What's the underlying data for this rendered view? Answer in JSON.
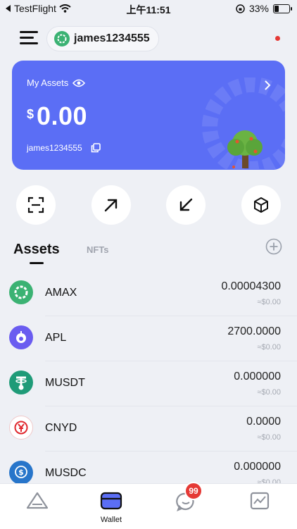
{
  "status_bar": {
    "back_app": "TestFlight",
    "time": "上午11:51",
    "battery": "33%",
    "icons": [
      "back-arrow-icon",
      "wifi-icon",
      "orientation-lock-icon",
      "battery-icon"
    ]
  },
  "header": {
    "account_name": "james1234555",
    "icons": [
      "menu-icon",
      "amax-logo-icon",
      "notification-dot"
    ]
  },
  "card": {
    "label": "My Assets",
    "currency": "$",
    "balance": "0.00",
    "account": "james1234555",
    "colors": {
      "background": "#5b6ef5",
      "text": "#ffffff"
    },
    "icons": [
      "eye-icon",
      "chevron-right-icon",
      "copy-icon",
      "tree-illustration"
    ]
  },
  "actions": [
    {
      "name": "scan",
      "icon": "scan-icon"
    },
    {
      "name": "send",
      "icon": "arrow-up-right-icon"
    },
    {
      "name": "receive",
      "icon": "arrow-down-left-icon"
    },
    {
      "name": "resources",
      "icon": "cube-icon"
    }
  ],
  "tabs": {
    "assets": "Assets",
    "nfts": "NFTs",
    "active": "Assets"
  },
  "tokens": [
    {
      "symbol": "AMAX",
      "balance": "0.00004300",
      "fiat": "≈$0.00",
      "icon": "amax-token-icon",
      "color": "#3bb273"
    },
    {
      "symbol": "APL",
      "balance": "2700.0000",
      "fiat": "≈$0.00",
      "icon": "apl-token-icon",
      "color": "#6a5cf0"
    },
    {
      "symbol": "MUSDT",
      "balance": "0.000000",
      "fiat": "≈$0.00",
      "icon": "musdt-token-icon",
      "color": "#1f9b78"
    },
    {
      "symbol": "CNYD",
      "balance": "0.0000",
      "fiat": "≈$0.00",
      "icon": "cnyd-token-icon",
      "color": "#e0282e"
    },
    {
      "symbol": "MUSDC",
      "balance": "0.000000",
      "fiat": "≈$0.00",
      "icon": "musdc-token-icon",
      "color": "#2775ca"
    }
  ],
  "bottom_nav": {
    "items": [
      {
        "label": "",
        "icon": "home-triangle-icon"
      },
      {
        "label": "Wallet",
        "icon": "wallet-icon",
        "active": true
      },
      {
        "label": "",
        "icon": "chat-icon",
        "badge": "99"
      },
      {
        "label": "",
        "icon": "market-chart-icon"
      }
    ]
  }
}
